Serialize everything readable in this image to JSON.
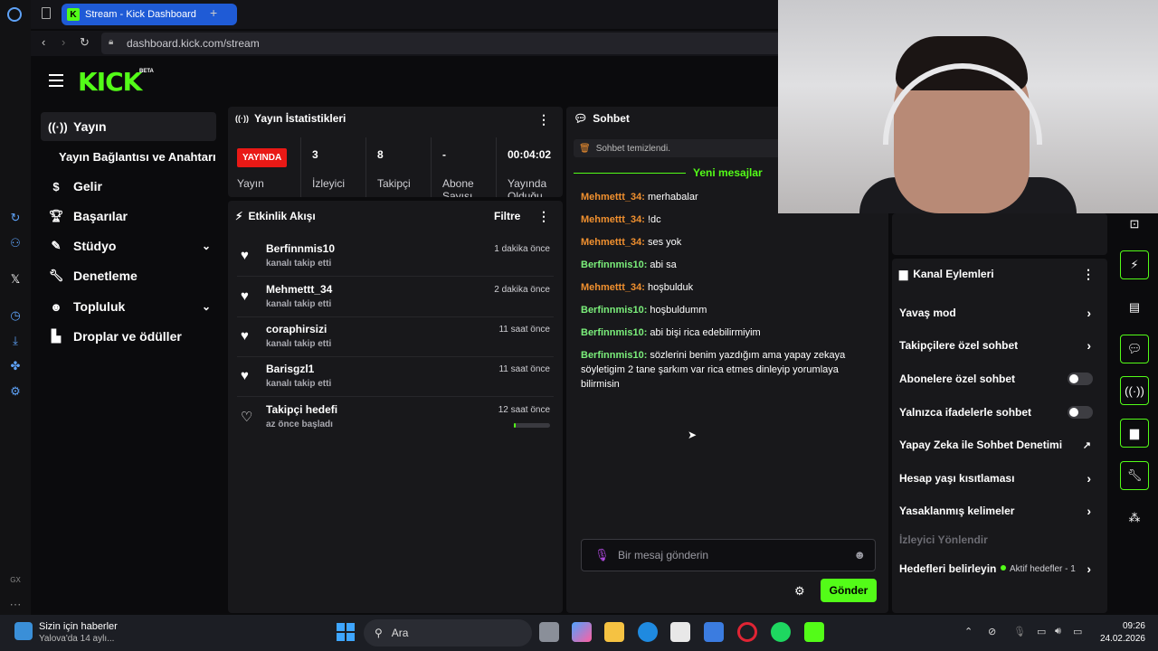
{
  "browser": {
    "tab_title": "Stream - Kick Dashboard",
    "url": "dashboard.kick.com/stream",
    "new_tab": "+"
  },
  "brand": {
    "logo": "KICK",
    "beta": "BETA",
    "accent": "#53fc18"
  },
  "sidebar": {
    "items": [
      {
        "label": "Yayın",
        "icon": "broadcast-icon"
      },
      {
        "label": "Yayın Bağlantısı ve Anahtarı",
        "icon": ""
      },
      {
        "label": "Gelir",
        "icon": "dollar-icon"
      },
      {
        "label": "Başarılar",
        "icon": "trophy-icon"
      },
      {
        "label": "Stüdyo",
        "icon": "brush-icon"
      },
      {
        "label": "Denetleme",
        "icon": "wrench-icon"
      },
      {
        "label": "Topluluk",
        "icon": "community-icon"
      },
      {
        "label": "Droplar ve ödüller",
        "icon": "drops-icon"
      }
    ]
  },
  "stats": {
    "title": "Yayın İstatistikleri",
    "live_badge": "YAYINDA",
    "live_label": "Yayın",
    "items": [
      {
        "value": "3",
        "label": "İzleyici"
      },
      {
        "value": "8",
        "label": "Takipçi"
      },
      {
        "value": "-",
        "label": "Abone Sayısı"
      },
      {
        "value": "00:04:02",
        "label": "Yayında Olduğu"
      }
    ]
  },
  "activity": {
    "title": "Etkinlik Akışı",
    "filter": "Filtre",
    "items": [
      {
        "name": "Berfinnmis10",
        "sub": "kanalı takip etti",
        "time": "1 dakika önce"
      },
      {
        "name": "Mehmettt_34",
        "sub": "kanalı takip etti",
        "time": "2 dakika önce"
      },
      {
        "name": "coraphirsizi",
        "sub": "kanalı takip etti",
        "time": "11 saat önce"
      },
      {
        "name": "Barisgzl1",
        "sub": "kanalı takip etti",
        "time": "11 saat önce"
      },
      {
        "name": "Takipçi hedefi",
        "sub": "az önce başladı",
        "time": "12 saat önce"
      }
    ],
    "goal_progress": 0.05
  },
  "chat": {
    "title": "Sohbet",
    "cleared": "Sohbet temizlendi.",
    "new_messages": "Yeni mesajlar",
    "messages": [
      {
        "user": "Mehmettt_34:",
        "text": "merhabalar"
      },
      {
        "user": "Mehmettt_34:",
        "text": "!dc"
      },
      {
        "user": "Mehmettt_34:",
        "text": "ses yok"
      },
      {
        "user": "Berfinnmis10:",
        "text": "abi sa"
      },
      {
        "user": "Mehmettt_34:",
        "text": "hoşbulduk"
      },
      {
        "user": "Berfinnmis10:",
        "text": "hoşbuldumm"
      },
      {
        "user": "Berfinnmis10:",
        "text": "abi bişi rica edebilirmiyim"
      },
      {
        "user": "Berfinnmis10:",
        "text": "sözlerini benim yazdığım ama yapay zekaya söyletigim 2 tane şarkım var rica etmes dinleyip yorumlaya bilirmisin"
      }
    ],
    "placeholder": "Bir mesaj gönderin",
    "send": "Gönder"
  },
  "channel": {
    "title": "Kanal Eylemleri",
    "settings": [
      {
        "label": "Yavaş mod",
        "control": "chevron"
      },
      {
        "label": "Takipçilere özel sohbet",
        "control": "chevron"
      },
      {
        "label": "Abonelere özel sohbet",
        "control": "toggle"
      },
      {
        "label": "Yalnızca ifadelerle sohbet",
        "control": "toggle"
      },
      {
        "label": "Yapay Zeka ile Sohbet Denetimi",
        "control": "external"
      },
      {
        "label": "Hesap yaşı kısıtlaması",
        "control": "chevron"
      },
      {
        "label": "Yasaklanmış kelimeler",
        "control": "chevron"
      },
      {
        "label": "İzleyici Yönlendir",
        "control": "none"
      },
      {
        "label": "Hedefleri belirleyin",
        "control": "chevron"
      }
    ],
    "goals_status": "Aktif hedefler - 1"
  },
  "taskbar": {
    "news_title": "Sizin için haberler",
    "news_sub": "Yalova'da 14 aylı...",
    "search": "Ara",
    "time": "09:26",
    "date": "24.02.2026"
  }
}
